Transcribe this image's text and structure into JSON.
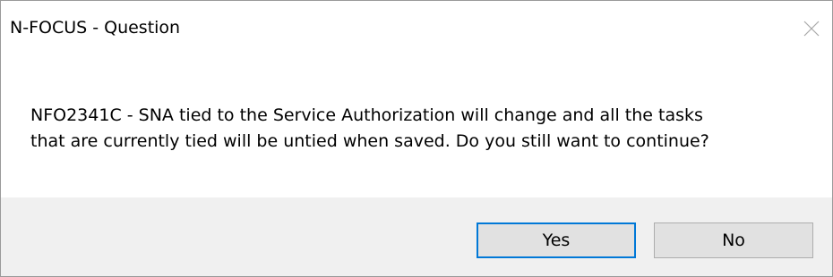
{
  "dialog": {
    "title": "N-FOCUS - Question",
    "close_icon": "close-icon",
    "message_line1": "NFO2341C - SNA tied to the Service Authorization will change and all the tasks",
    "message_line2": "that are currently tied will be untied when saved. Do you still want to continue?",
    "buttons": {
      "yes_label": "Yes",
      "no_label": "No"
    }
  },
  "colors": {
    "footer_background": "#f0f0f0",
    "button_background": "#e1e1e1",
    "default_button_border": "#0078d7",
    "window_border": "#9a9a9a"
  }
}
